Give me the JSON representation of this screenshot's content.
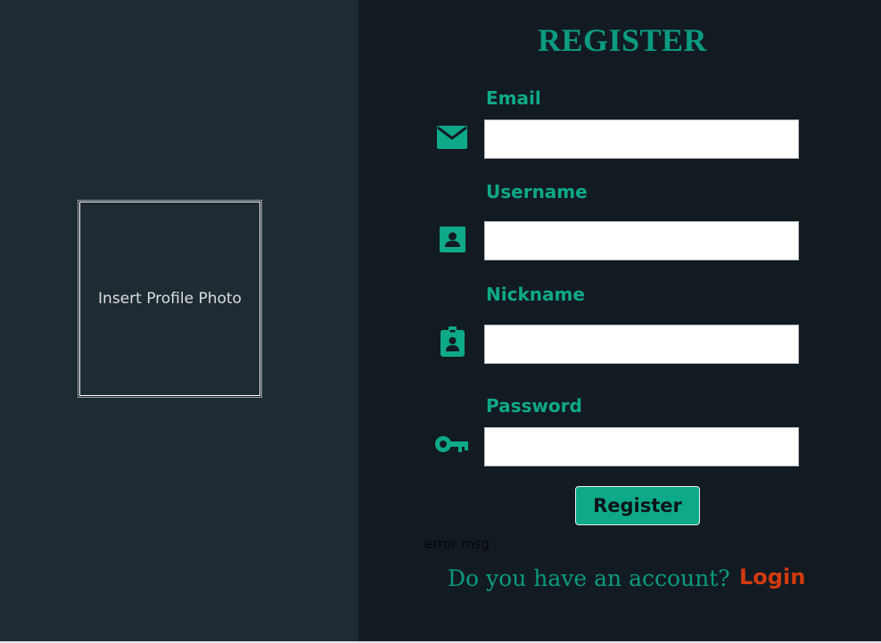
{
  "title": "REGISTER",
  "photo": {
    "label": "Insert Profile Photo"
  },
  "fields": {
    "email": {
      "label": "Email",
      "value": "",
      "icon": "envelope-icon"
    },
    "username": {
      "label": "Username",
      "value": "",
      "icon": "contact-card-icon"
    },
    "nickname": {
      "label": "Nickname",
      "value": "",
      "icon": "id-badge-icon"
    },
    "password": {
      "label": "Password",
      "value": "",
      "icon": "key-icon"
    }
  },
  "register_button": {
    "label": "Register"
  },
  "error": {
    "text": "error msg"
  },
  "footer": {
    "question": "Do you have an account?",
    "login_label": "Login"
  },
  "colors": {
    "accent": "#0ea988",
    "left_panel_bg": "#1f2b33",
    "right_panel_bg": "#131b22",
    "login_link": "#d23a0e"
  }
}
